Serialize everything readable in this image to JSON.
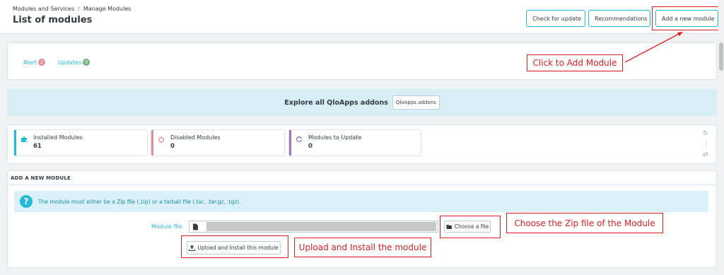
{
  "header": {
    "breadcrumb": [
      "Modules and Services",
      "Manage Modules"
    ],
    "breadcrumb_separator": "/",
    "title": "List of modules",
    "buttons": {
      "check_update": "Check for update",
      "recommendations": "Recommendations",
      "add_module": "Add a new module"
    }
  },
  "notifications": {
    "alert_label": "Alert",
    "alert_count": "2",
    "updates_label": "Updates",
    "updates_count": "0"
  },
  "explore": {
    "text": "Explore all QloApps addons",
    "button": "QloApps addons"
  },
  "kpis": [
    {
      "label": "Installed Modules",
      "value": "61",
      "icon": "puzzle-icon",
      "color": "#25b9d7"
    },
    {
      "label": "Disabled Modules",
      "value": "0",
      "icon": "power-icon",
      "color": "#e08f95"
    },
    {
      "label": "Modules to Update",
      "value": "0",
      "icon": "refresh-icon",
      "color": "#a471bd"
    }
  ],
  "add_module": {
    "section_title": "ADD A NEW MODULE",
    "info": "The module must either be a Zip file (.zip) or a tarball file (.tar, .tar.gz, .tgz).",
    "field_label": "Module file",
    "choose_button": "Choose a file",
    "upload_button": "Upload and Install this module"
  },
  "annotations": {
    "click_add": "Click to Add Module",
    "choose_zip": "Choose the Zip file of the Module",
    "upload_install": "Upload and Install the module"
  },
  "colors": {
    "accent": "#25b9d7",
    "annotation": "#e02020",
    "alert_badge": "#e08f95",
    "updates_badge": "#70b580"
  }
}
